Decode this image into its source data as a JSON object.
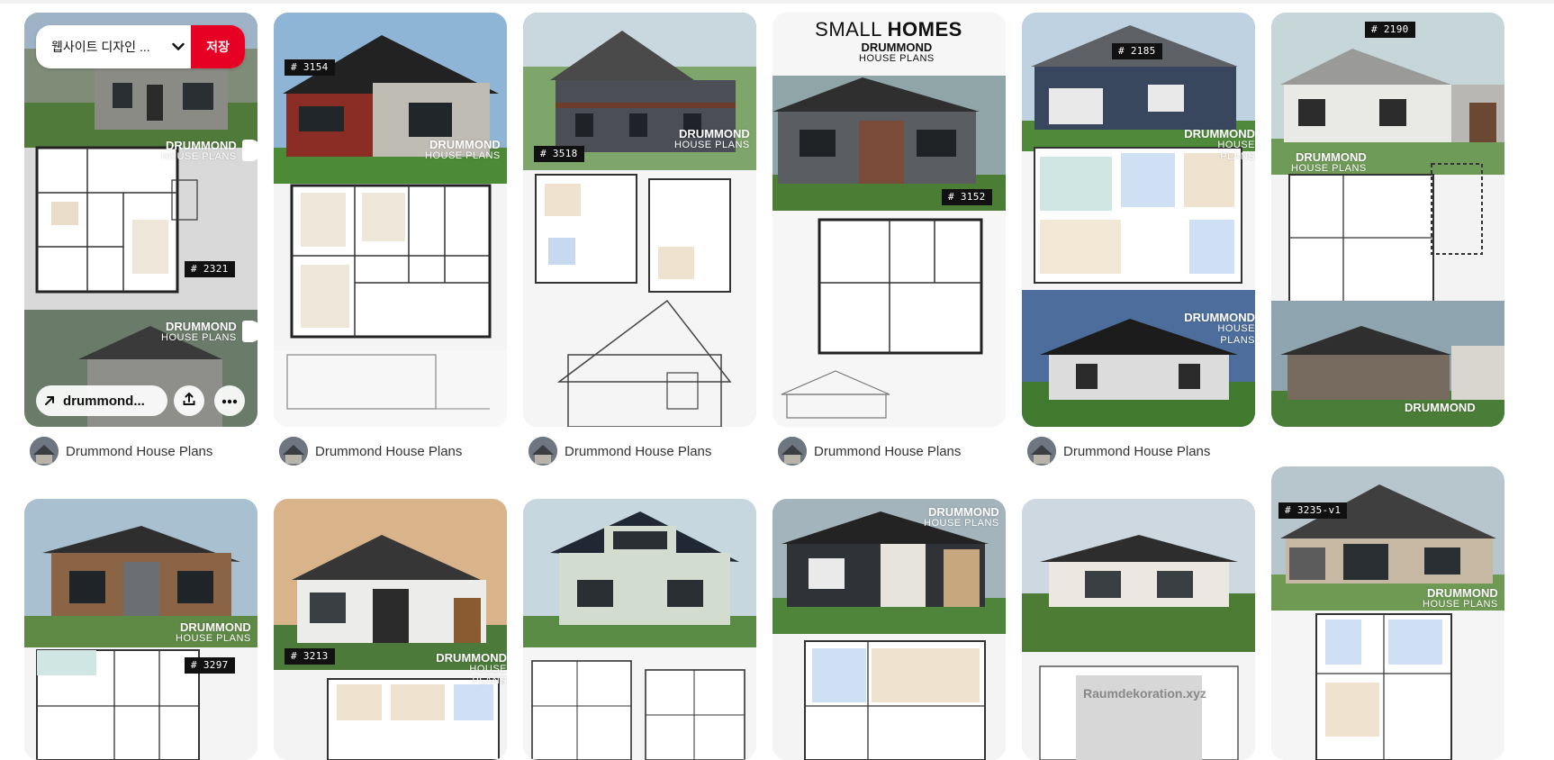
{
  "colors": {
    "save_red": "#e60023",
    "badge_black": "#111111",
    "text_gray": "#333333"
  },
  "save_overlay": {
    "board_label": "웹사이트 디자인 ...",
    "board_chevron_icon": "chevron-down-icon",
    "save_label": "저장",
    "link_label": "drummond...",
    "link_icon": "arrow-up-right-icon",
    "share_icon": "share-icon",
    "more_icon": "more-horizontal-icon"
  },
  "pins": [
    {
      "author": "Drummond House Plans",
      "badge": "# 2321",
      "brand": "DRUMMOND",
      "brand_sub": "HOUSE PLANS"
    },
    {
      "author": "Drummond House Plans",
      "badge": "# 3154",
      "brand": "DRUMMOND",
      "brand_sub": "HOUSE PLANS"
    },
    {
      "author": "Drummond House Plans",
      "badge": "# 3518",
      "brand": "DRUMMOND",
      "brand_sub": "HOUSE PLANS"
    },
    {
      "author": "Drummond House Plans",
      "badge": "# 3152",
      "heading_small": "SMALL ",
      "heading_bold": "HOMES",
      "brand": "DRUMMOND",
      "brand_sub": "HOUSE PLANS"
    },
    {
      "author": "Drummond House Plans",
      "badge": "# 2185",
      "brand": "DRUMMOND",
      "brand_sub": "HOUSE PLANS"
    },
    {
      "badge": "# 2190",
      "brand": "DRUMMOND",
      "brand_sub": "HOUSE PLANS"
    },
    {
      "badge": "# 3297",
      "brand": "DRUMMOND",
      "brand_sub": "HOUSE PLANS"
    },
    {
      "badge": "# 3213",
      "brand": "DRUMMOND",
      "brand_sub": "HOUSE PLANS"
    },
    {},
    {
      "brand": "DRUMMOND",
      "brand_sub": "HOUSE PLANS"
    },
    {
      "watermark": "Raumdekoration.xyz"
    },
    {
      "badge": "# 3235-v1",
      "brand": "DRUMMOND",
      "brand_sub": "HOUSE PLANS"
    }
  ]
}
